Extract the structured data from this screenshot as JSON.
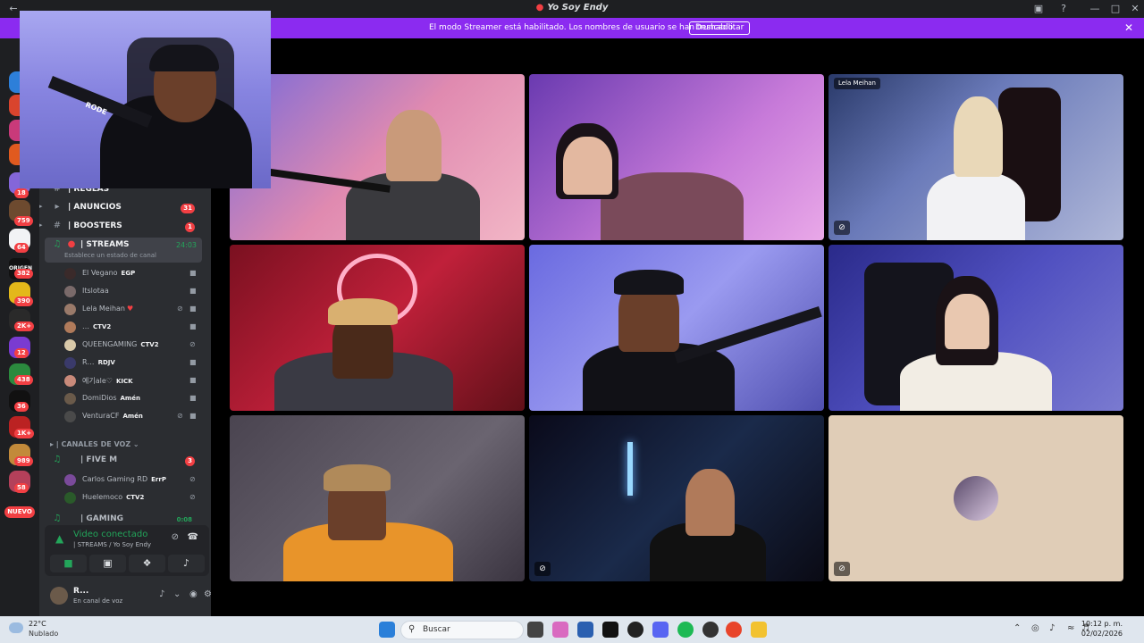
{
  "window": {
    "title": "Yo Soy Endy"
  },
  "banner": {
    "text": "El modo Streamer está habilitado. Los nombres de usuario se han truncado.",
    "button": "Deshabilitar"
  },
  "rail": {
    "badges": [
      "NU",
      "18",
      "759",
      "64",
      "382",
      "390",
      "2K+",
      "12",
      "438",
      "36",
      "1K+",
      "989",
      "58"
    ],
    "new_label": "NUEVO",
    "origen_label": "ORIGEN"
  },
  "webcam": {
    "mic_brand": "RODE"
  },
  "channels": {
    "reglas": "| REGLAS",
    "anuncios": "| ANUNCIOS",
    "anuncios_badge": "31",
    "boosters": "| BOOSTERS",
    "boosters_badge": "1",
    "streams": "| STREAMS",
    "streams_timer": "24:03",
    "streams_status": "Establece un estado de canal",
    "category_voice": "CANALES DE VOZ",
    "fivem": "| FIVE M",
    "fivem_badge": "3",
    "gaming": "| GAMING",
    "gaming_timer": "0:08"
  },
  "stream_users": [
    {
      "name": "El Vegano",
      "tag": "EGP"
    },
    {
      "name": "Itslotaa",
      "tag": ""
    },
    {
      "name": "Lela Meihan",
      "tag": ""
    },
    {
      "name": "…",
      "tag": "CTV2"
    },
    {
      "name": "QUEENGAMING",
      "tag": "CTV2"
    },
    {
      "name": "R…",
      "tag": "RDJV"
    },
    {
      "name": "예기ale♡",
      "tag": "KICK"
    },
    {
      "name": "DomiDios",
      "tag": "Amén"
    },
    {
      "name": "VenturaCF",
      "tag": "Amén"
    }
  ],
  "fivem_users": [
    {
      "name": "Carlos Gaming RD",
      "tag": "ErrP"
    },
    {
      "name": "Huelemoco",
      "tag": "CTV2"
    }
  ],
  "voice_panel": {
    "status": "Video conectado",
    "location": "| STREAMS / Yo Soy Endy"
  },
  "user_panel": {
    "name": "R...",
    "status": "En canal de voz"
  },
  "tiles": {
    "lela_name": "Lela Meihan"
  },
  "taskbar": {
    "weather_temp": "22°C",
    "weather_desc": "Nublado",
    "search": "Buscar",
    "time": "10:12 p. m.",
    "date": "02/02/2026"
  },
  "colors": {
    "accent": "#8b2bf0",
    "online": "#23a55a",
    "danger": "#f23f43"
  }
}
